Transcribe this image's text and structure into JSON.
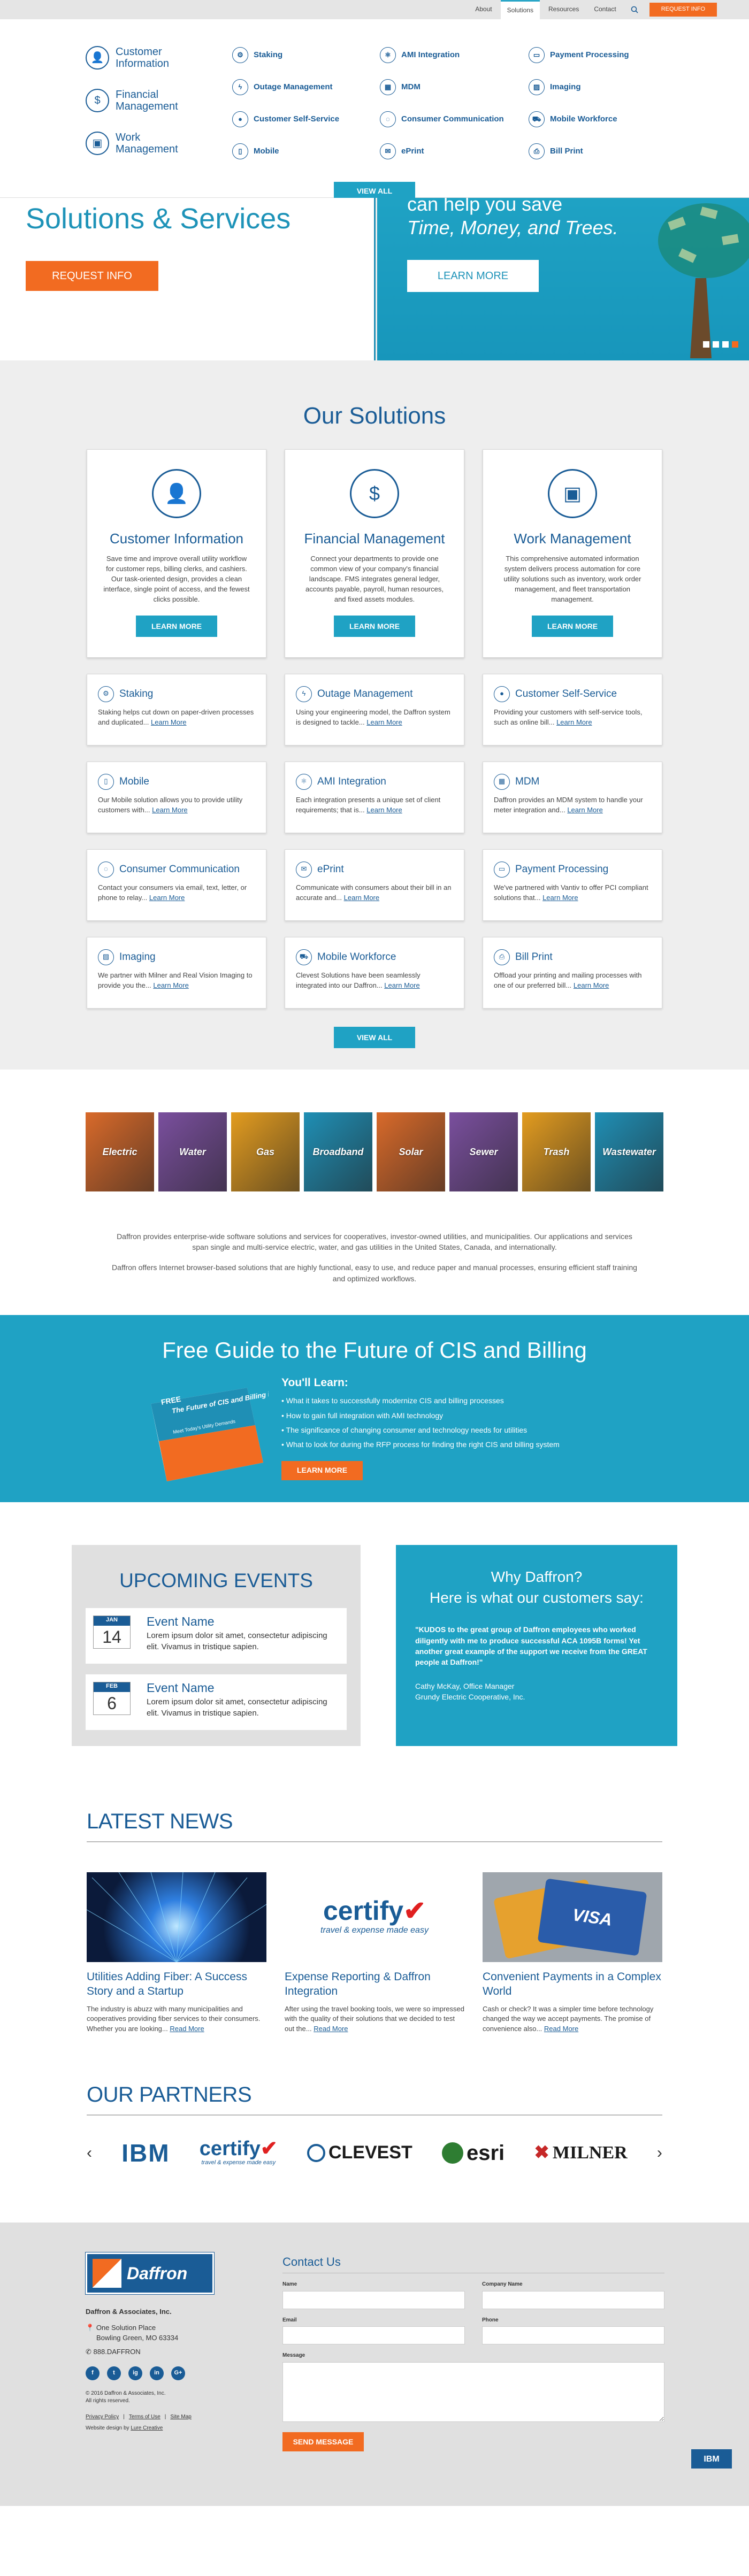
{
  "topnav": {
    "links": [
      "About",
      "Solutions",
      "Resources",
      "Contact"
    ],
    "request": "REQUEST INFO"
  },
  "mega": {
    "big": [
      {
        "label": "Customer Information",
        "icon": "person-icon"
      },
      {
        "label": "Financial Management",
        "icon": "dollar-icon"
      },
      {
        "label": "Work Management",
        "icon": "briefcase-icon"
      }
    ],
    "cols": [
      [
        "Staking",
        "Outage Management",
        "Customer Self-Service",
        "Mobile"
      ],
      [
        "AMI Integration",
        "MDM",
        "Consumer Communication",
        "ePrint"
      ],
      [
        "Payment Processing",
        "Imaging",
        "Mobile Workforce",
        "Bill Print"
      ]
    ],
    "view_all": "VIEW ALL"
  },
  "hero": {
    "title": "Solutions & Services",
    "request": "REQUEST INFO",
    "line1": "can help you save",
    "line2": "Time, Money, and Trees.",
    "learn": "LEARN MORE"
  },
  "solutions": {
    "title": "Our Solutions",
    "big": [
      {
        "title": "Customer Information",
        "text": "Save time and improve overall utility workflow for customer reps, billing clerks, and cashiers. Our task-oriented design, provides a clean interface, single point of access, and the fewest clicks possible.",
        "btn": "LEARN MORE"
      },
      {
        "title": "Financial Management",
        "text": "Connect your departments to provide one common view of your company's financial landscape. FMS integrates general ledger, accounts payable, payroll, human resources, and fixed assets modules.",
        "btn": "LEARN MORE"
      },
      {
        "title": "Work Management",
        "text": "This comprehensive automated information system delivers process automation for core utility solutions such as inventory, work order management, and fleet transportation management.",
        "btn": "LEARN MORE"
      }
    ],
    "small": [
      {
        "title": "Staking",
        "text": "Staking helps cut down on paper-driven processes and duplicated...",
        "rm": "Learn More"
      },
      {
        "title": "Outage Management",
        "text": "Using your engineering model, the Daffron system is designed to tackle...",
        "rm": "Learn More"
      },
      {
        "title": "Customer Self-Service",
        "text": "Providing your customers with self-service tools, such as online bill...",
        "rm": "Learn More"
      },
      {
        "title": "Mobile",
        "text": "Our Mobile solution allows you to provide utility customers with...",
        "rm": "Learn More"
      },
      {
        "title": "AMI Integration",
        "text": "Each integration presents a unique set of client requirements; that is...",
        "rm": "Learn More"
      },
      {
        "title": "MDM",
        "text": "Daffron provides an MDM system to handle your meter integration and...",
        "rm": "Learn More"
      },
      {
        "title": "Consumer Communication",
        "text": "Contact your consumers via email, text, letter, or phone to relay...",
        "rm": "Learn More"
      },
      {
        "title": "ePrint",
        "text": "Communicate with consumers about their bill in an accurate and...",
        "rm": "Learn More"
      },
      {
        "title": "Payment Processing",
        "text": "We've partnered with Vantiv to offer PCI compliant solutions that...",
        "rm": "Learn More"
      },
      {
        "title": "Imaging",
        "text": "We partner with Milner and Real Vision Imaging to provide you the...",
        "rm": "Learn More"
      },
      {
        "title": "Mobile Workforce",
        "text": "Clevest Solutions have been seamlessly integrated into our Daffron...",
        "rm": "Learn More"
      },
      {
        "title": "Bill Print",
        "text": "Offload your printing and mailing processes with one of our preferred bill...",
        "rm": "Learn More"
      }
    ],
    "view_all": "VIEW ALL"
  },
  "markets": {
    "tiles": [
      {
        "label": "Electric",
        "color": "#d96a2a"
      },
      {
        "label": "Water",
        "color": "#7a4f9e"
      },
      {
        "label": "Gas",
        "color": "#e39c1f"
      },
      {
        "label": "Broadband",
        "color": "#1f8fb5"
      },
      {
        "label": "Solar",
        "color": "#d96a2a"
      },
      {
        "label": "Sewer",
        "color": "#7a4f9e"
      },
      {
        "label": "Trash",
        "color": "#e39c1f"
      },
      {
        "label": "Wastewater",
        "color": "#1f8fb5"
      }
    ],
    "p1": "Daffron provides enterprise-wide software solutions and services for cooperatives, investor-owned utilities, and municipalities. Our applications and services span single and multi-service electric, water, and gas utilities in the United States, Canada, and internationally.",
    "p2": "Daffron offers Internet browser-based solutions that are highly functional, easy to use, and reduce paper and manual processes, ensuring efficient staff training and optimized workflows."
  },
  "guide": {
    "title": "Free Guide to the Future of CIS and Billing",
    "book_free": "FREE",
    "book_title": "The Future of CIS and Billing is Here",
    "book_sub": "Meet Today's Utility Demands",
    "learn_title": "You'll Learn:",
    "items": [
      "What it takes to successfully modernize CIS and billing processes",
      "How to gain full integration with AMI technology",
      "The significance of changing consumer and technology needs for utilities",
      "What to look for during the RFP process for finding the right CIS and billing system"
    ],
    "learn": "LEARN MORE"
  },
  "events": {
    "title": "UPCOMING EVENTS",
    "items": [
      {
        "month": "JAN",
        "day": "14",
        "name": "Event Name",
        "text": "Lorem ipsum dolor sit amet, consectetur adipiscing elit. Vivamus in tristique sapien."
      },
      {
        "month": "FEB",
        "day": "6",
        "name": "Event Name",
        "text": "Lorem ipsum dolor sit amet, consectetur adipiscing elit. Vivamus in tristique sapien."
      }
    ]
  },
  "why": {
    "title1": "Why Daffron?",
    "title2": "Here is what our customers say:",
    "quote": "\"KUDOS to the great group of Daffron employees who worked diligently with me to produce successful ACA 1095B forms! Yet another great example of the support we receive from the GREAT people at Daffron!\"",
    "name": "Cathy McKay, Office Manager",
    "org": "Grundy Electric Cooperative, Inc."
  },
  "news": {
    "title": "LATEST NEWS",
    "items": [
      {
        "title": "Utilities Adding Fiber: A Success Story and a Startup",
        "text": "The industry is abuzz with many municipalities and cooperatives providing fiber services to their consumers. Whether you are looking...",
        "rm": "Read More"
      },
      {
        "title": "Expense Reporting & Daffron Integration",
        "text": "After using the travel booking tools, we were so impressed with the quality of their solutions that we decided to test out the...",
        "rm": "Read More",
        "logo": "certify",
        "tag": "travel & expense made easy"
      },
      {
        "title": "Convenient Payments in a Complex World",
        "text": "Cash or check? It was a simpler time before tech­nology changed the way we accept payments. The promise of convenience also...",
        "rm": "Read More",
        "card": "VISA"
      }
    ]
  },
  "partners": {
    "title": "OUR PARTNERS",
    "logos": [
      "IBM",
      "certify",
      "CLEVEST",
      "esri",
      "MILNER"
    ],
    "certify_tag": "travel & expense made easy"
  },
  "footer": {
    "logo": "Daffron",
    "company": "Daffron & Associates, Inc.",
    "addr1": "One Solution Place",
    "addr2": "Bowling Green, MO 63334",
    "phone": "888.DAFFRON",
    "social": [
      "f",
      "t",
      "ig",
      "in",
      "G+"
    ],
    "copy1": "© 2016 Daffron & Associates, Inc.",
    "copy2": "All rights reserved.",
    "links": [
      "Privacy Policy",
      "Terms of Use",
      "Site Map"
    ],
    "design_prefix": "Website design by",
    "design": "Lure Creative",
    "contact_title": "Contact Us",
    "f_name": "Name",
    "f_company": "Company Name",
    "f_email": "Email",
    "f_phone": "Phone",
    "f_message": "Message",
    "send": "SEND MESSAGE",
    "ibm": "IBM"
  }
}
